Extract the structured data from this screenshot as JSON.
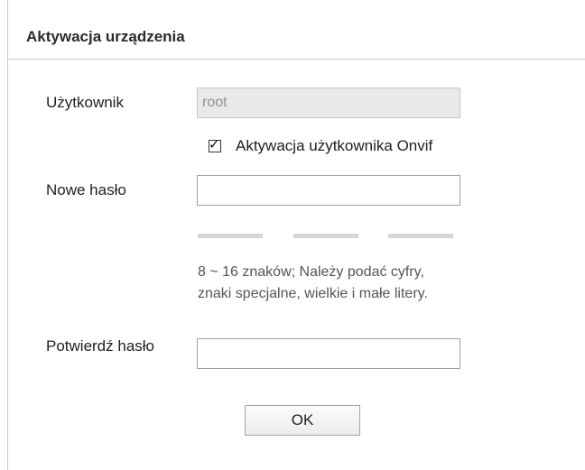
{
  "dialog": {
    "title": "Aktywacja urządzenia",
    "user": {
      "label": "Użytkownik",
      "value": "root"
    },
    "onvif": {
      "checked": true,
      "label": "Aktywacja użytkownika Onvif"
    },
    "new_password": {
      "label": "Nowe hasło",
      "value": ""
    },
    "strength_bars": 3,
    "hint": {
      "line1": "8 ~ 16 znaków; Należy podać cyfry,",
      "line2": "znaki specjalne, wielkie i małe litery."
    },
    "confirm_password": {
      "label": "Potwierdź hasło",
      "value": ""
    },
    "ok_label": "OK"
  }
}
